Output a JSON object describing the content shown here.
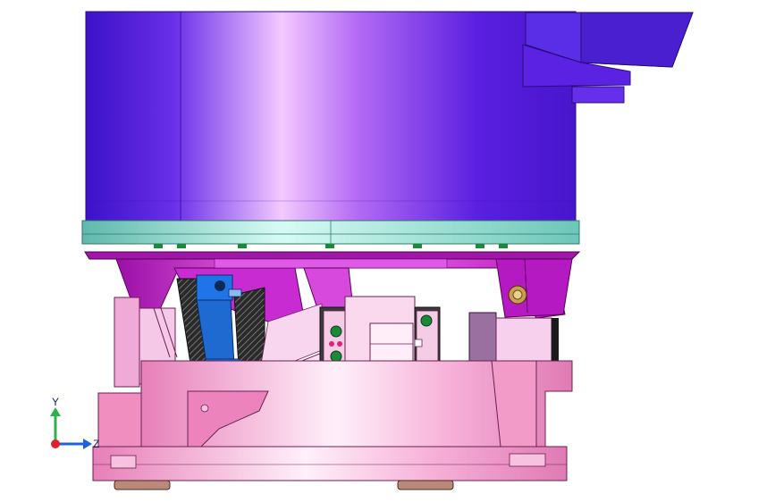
{
  "viewport": {
    "background": "#ffffff",
    "model": {
      "colors": {
        "bowl": "#5a1fe0",
        "bowl_highlight": "#f3c9ff",
        "ring": "#7fd6c8",
        "bracket": "#c81bd0",
        "base": "#f08ec0",
        "base_light": "#ffd8ef",
        "clamp_blue": "#1f74e8",
        "screw_green": "#1a8a3a",
        "feet": "#b98a7a"
      }
    },
    "triad": {
      "x_label": "",
      "y_label": "Y",
      "z_label": "Z",
      "colors": {
        "x": "#e0202a",
        "y": "#2bb34a",
        "z": "#1f5fe0"
      }
    }
  }
}
